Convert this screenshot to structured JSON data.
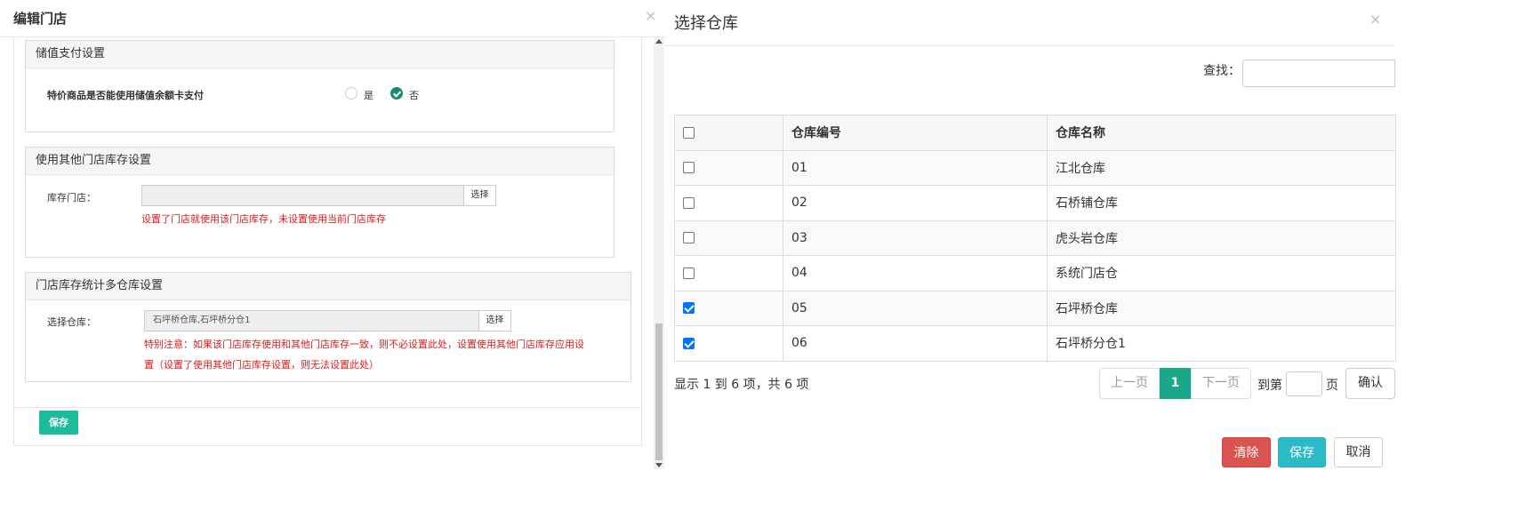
{
  "left_modal": {
    "title": "编辑门店",
    "close": "×",
    "panel1": {
      "heading": "储值支付设置",
      "question": "特价商品是否能使用储值余额卡支付",
      "option_yes": "是",
      "option_no": "否",
      "selected": "否"
    },
    "panel2": {
      "heading": "使用其他门店库存设置",
      "field_label": "库存门店：",
      "field_value": "",
      "select_button": "选择",
      "hint": "设置了门店就使用该门店库存，未设置使用当前门店库存"
    },
    "panel3": {
      "heading": "门店库存统计多仓库设置",
      "field_label": "选择仓库：",
      "field_value": "石坪桥仓库,石坪桥分仓1",
      "select_button": "选择",
      "hint_line1": "特别注意：如果该门店库存使用和其他门店库存一致，则不必设置此处，设置使用其他门店库存应用设",
      "hint_line2": "置（设置了使用其他门店库存设置，则无法设置此处）"
    },
    "save_button": "保存"
  },
  "right_modal": {
    "title": "选择仓库",
    "close": "×",
    "search_label": "查找：",
    "search_value": "",
    "columns": [
      "",
      "仓库编号",
      "仓库名称"
    ],
    "rows": [
      {
        "code": "01",
        "name": "江北仓库",
        "checked": false
      },
      {
        "code": "02",
        "name": "石桥铺仓库",
        "checked": false
      },
      {
        "code": "03",
        "name": "虎头岩仓库",
        "checked": false
      },
      {
        "code": "04",
        "name": "系统门店仓",
        "checked": false
      },
      {
        "code": "05",
        "name": "石坪桥仓库",
        "checked": true
      },
      {
        "code": "06",
        "name": "石坪桥分仓1",
        "checked": true
      }
    ],
    "info": "显示 1 到 6 项，共 6 项",
    "pagination": {
      "prev": "上一页",
      "current": "1",
      "next": "下一页",
      "goto_prefix": "到第",
      "goto_suffix": "页",
      "confirm": "确认"
    },
    "buttons": {
      "clear": "清除",
      "save": "保存",
      "cancel": "取消"
    },
    "colors": {
      "primary_green": "#1ba88a",
      "cyan": "#2bbbc6",
      "danger": "#d9534f",
      "hint_red": "#e01b1b"
    }
  }
}
